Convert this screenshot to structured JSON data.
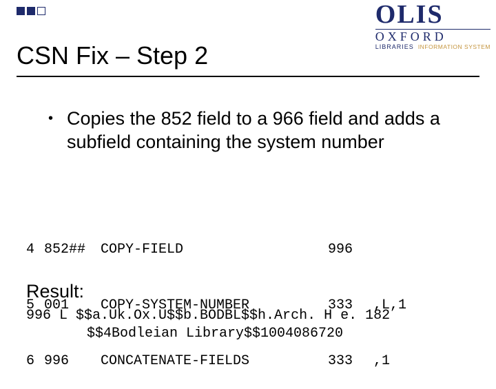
{
  "logo": {
    "brand": "OLIS",
    "org": "OXFORD",
    "libraries": "LIBRARIES",
    "info": "INFORMATION SYSTEM"
  },
  "title": "CSN Fix – Step 2",
  "bullet": "Copies the 852 field to a 966 field and adds a subfield containing the system number",
  "code": {
    "rows": [
      {
        "idx": "4",
        "tag": "852##",
        "cmd": "COPY-FIELD",
        "dst": "996",
        "rest": ""
      },
      {
        "idx": "5",
        "tag": "001",
        "cmd": "COPY-SYSTEM-NUMBER",
        "dst": "333",
        "rest": ",L,1"
      },
      {
        "idx": "6",
        "tag": "996",
        "cmd": "CONCATENATE-FIELDS",
        "dst": "333",
        "rest": ",1"
      }
    ]
  },
  "result_label": "Result:",
  "result": {
    "line1": "996   L $$a.Uk.Ox.U$$b.BODBL$$h.Arch. H e. 182",
    "line2": "$$4Bodleian Library$$1004086720"
  }
}
